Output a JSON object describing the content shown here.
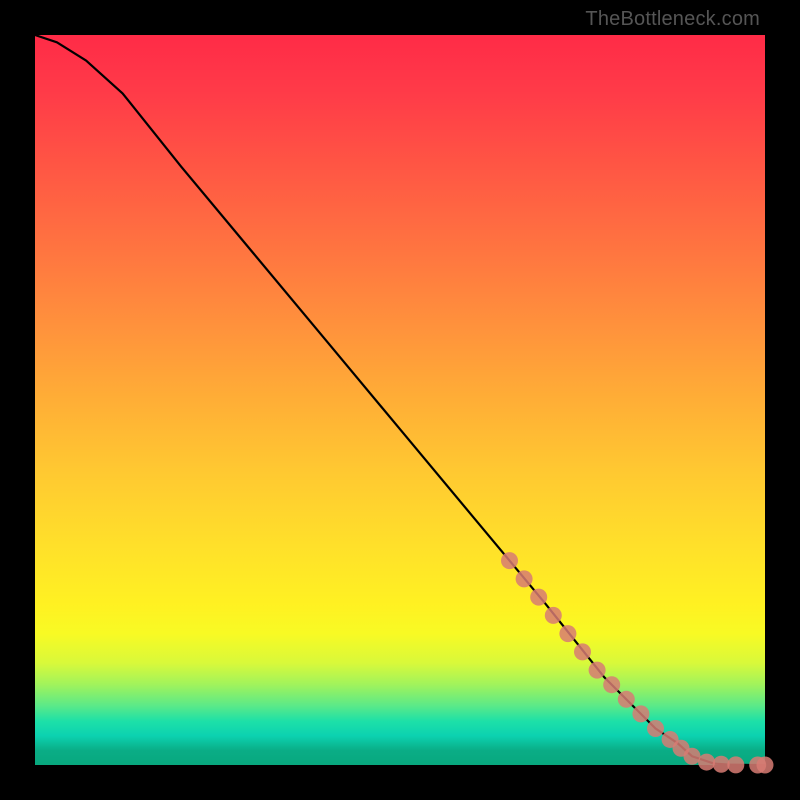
{
  "watermark": "TheBottleneck.com",
  "colors": {
    "bg": "#000000",
    "curve": "#000000",
    "marker_fill": "#d77b73",
    "marker_stroke": "#d77b73"
  },
  "chart_data": {
    "type": "line",
    "title": "",
    "xlabel": "",
    "ylabel": "",
    "xlim": [
      0,
      100
    ],
    "ylim": [
      0,
      100
    ],
    "grid": false,
    "legend": false,
    "series": [
      {
        "name": "curve",
        "x": [
          0,
          3,
          7,
          12,
          20,
          30,
          40,
          50,
          60,
          65,
          70,
          74,
          78,
          82,
          85,
          88,
          90,
          93,
          95,
          98,
          100
        ],
        "values": [
          100,
          99,
          96.5,
          92,
          82,
          70,
          58,
          46,
          34,
          28,
          22,
          17,
          12,
          8,
          5,
          3,
          1.2,
          0.2,
          0.05,
          0.0,
          0.0
        ]
      }
    ],
    "markers": [
      {
        "x": 65,
        "y": 28
      },
      {
        "x": 67,
        "y": 25.5
      },
      {
        "x": 69,
        "y": 23
      },
      {
        "x": 71,
        "y": 20.5
      },
      {
        "x": 73,
        "y": 18
      },
      {
        "x": 75,
        "y": 15.5
      },
      {
        "x": 77,
        "y": 13
      },
      {
        "x": 79,
        "y": 11
      },
      {
        "x": 81,
        "y": 9
      },
      {
        "x": 83,
        "y": 7
      },
      {
        "x": 85,
        "y": 5
      },
      {
        "x": 87,
        "y": 3.5
      },
      {
        "x": 88.5,
        "y": 2.3
      },
      {
        "x": 90,
        "y": 1.2
      },
      {
        "x": 92,
        "y": 0.4
      },
      {
        "x": 94,
        "y": 0.1
      },
      {
        "x": 96,
        "y": 0.02
      },
      {
        "x": 99,
        "y": 0.0
      },
      {
        "x": 100,
        "y": 0.0
      }
    ]
  }
}
